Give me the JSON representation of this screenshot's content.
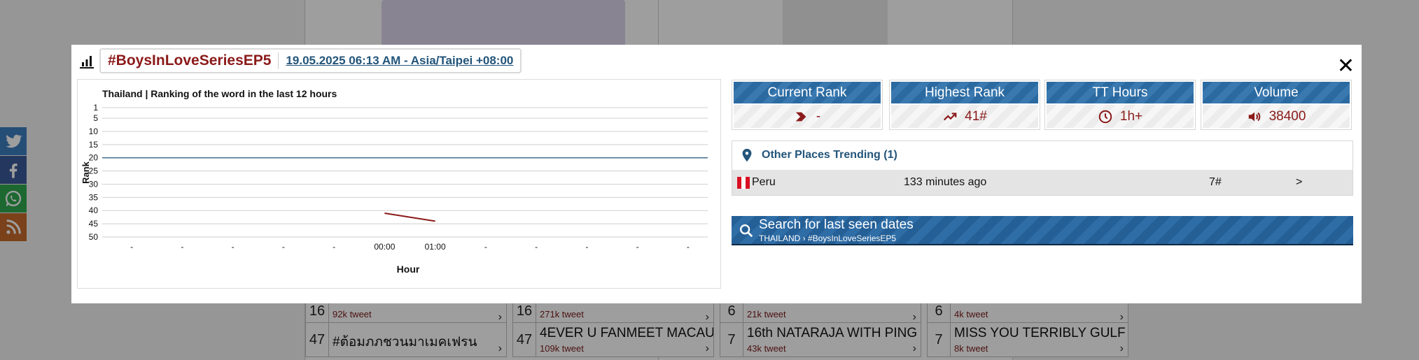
{
  "background": {
    "cards": [
      {
        "rank": "",
        "tweets": "92k tweet",
        "arrow": "›"
      },
      {
        "rank": "",
        "tweets": "271k tweet",
        "arrow": "›"
      },
      {
        "rank": "",
        "tweets": "21k tweet",
        "arrow": "›"
      },
      {
        "rank": "",
        "tweets": "4k tweet",
        "arrow": "›"
      },
      {
        "rank": "47",
        "name": "#ต้อมภภชวนมาเมคเฟรน",
        "tweets": "",
        "arrow": "›"
      },
      {
        "rank": "47",
        "name": "4EVER U FANMEET MACAU",
        "tweets": "109k tweet",
        "arrow": "›"
      },
      {
        "rank": "7",
        "name": "16th NATARAJA WITH PING",
        "tweets": "43k tweet",
        "arrow": "›"
      },
      {
        "rank": "7",
        "name": "MISS YOU TERRIBLY GULF",
        "tweets": "8k tweet",
        "arrow": "›"
      }
    ],
    "social": [
      "twitter-icon",
      "facebook-icon",
      "whatsapp-icon",
      "rss-icon"
    ]
  },
  "modal": {
    "hashtag": "#BoysInLoveSeriesEP5",
    "datetime": "19.05.2025 06:13 AM - Asia/Taipei +08:00",
    "close_label": "✕"
  },
  "chart_data": {
    "type": "line",
    "title": "Thailand | Ranking of the word in the last 12 hours",
    "xlabel": "Hour",
    "ylabel": "Rank",
    "x": [
      "-",
      "-",
      "-",
      "-",
      "-",
      "00:00",
      "01:00",
      "-",
      "-",
      "-",
      "-",
      "-"
    ],
    "yticks": [
      1,
      5,
      10,
      15,
      20,
      25,
      30,
      35,
      40,
      45,
      50
    ],
    "ylim": [
      1,
      50
    ],
    "y_reversed": true,
    "grid": true,
    "series": [
      {
        "values": [
          null,
          null,
          null,
          null,
          null,
          41,
          44,
          null,
          null,
          null,
          null,
          null
        ],
        "color": "#8b1a1a"
      }
    ],
    "reference_line": {
      "value": 20,
      "color": "#23557a"
    }
  },
  "stats": [
    {
      "label": "Current Rank",
      "value": "-",
      "icon": "chevron-right-icon"
    },
    {
      "label": "Highest Rank",
      "value": "41#",
      "icon": "trending-up-icon"
    },
    {
      "label": "TT Hours",
      "value": "1h+",
      "icon": "clock-icon"
    },
    {
      "label": "Volume",
      "value": "38400",
      "icon": "volume-icon"
    }
  ],
  "other_places": {
    "title": "Other Places Trending (1)",
    "rows": [
      {
        "country": "Peru",
        "ago": "133 minutes ago",
        "rank": "7#",
        "arrow": ">",
        "flag_colors": [
          "#d91023",
          "#ffffff",
          "#d91023"
        ]
      }
    ]
  },
  "search": {
    "label": "Search for last seen dates",
    "breadcrumb": "THAILAND › #BoysInLoveSeriesEP5"
  },
  "colors": {
    "accent_red": "#8b1a1a",
    "accent_blue": "#23557a",
    "stat_blue": "#2b6aa1"
  }
}
